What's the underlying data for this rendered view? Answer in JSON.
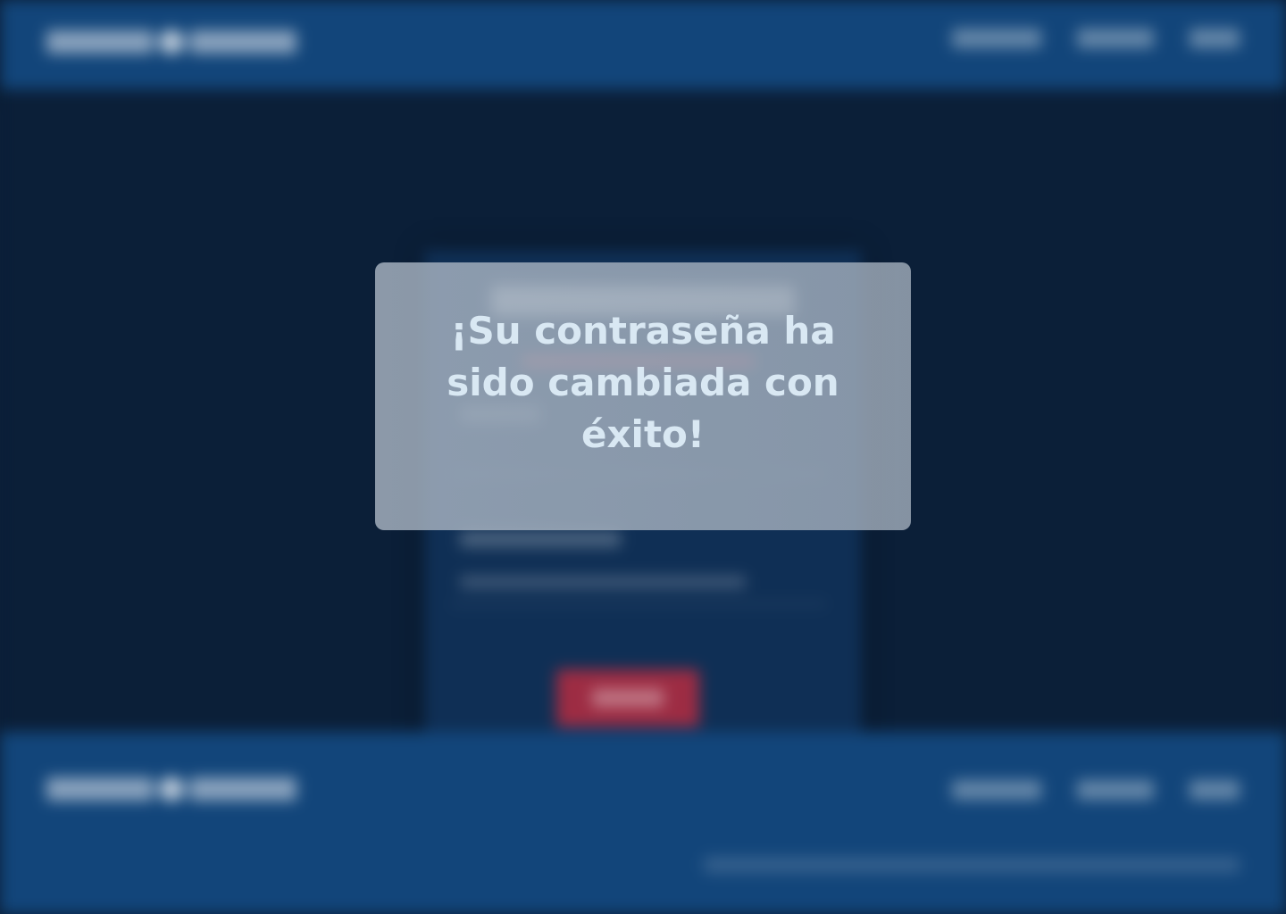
{
  "modal": {
    "message": "¡Su contraseña ha sido cambiada con éxito!"
  },
  "colors": {
    "header_bg": "#12457a",
    "page_bg": "#0b1f38",
    "card_bg": "#0f2f55",
    "accent": "#9d2c43",
    "modal_text": "#d9e8f3"
  }
}
